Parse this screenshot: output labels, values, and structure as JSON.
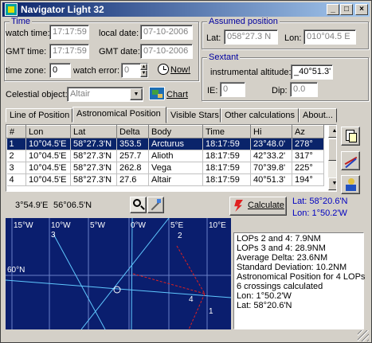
{
  "window": {
    "title": "Navigator Light 32",
    "controls": [
      "_",
      "□",
      "×"
    ]
  },
  "time": {
    "title": "Time",
    "watch_time_label": "watch time:",
    "watch_time": "17:17:59",
    "local_date_label": "local date:",
    "local_date": "07-10-2006",
    "gmt_time_label": "GMT time:",
    "gmt_time": "17:17:59",
    "gmt_date_label": "GMT date:",
    "gmt_date": "07-10-2006",
    "time_zone_label": "time zone:",
    "time_zone": "0",
    "watch_error_label": "watch error:",
    "watch_error": "0",
    "now_label": "Now!"
  },
  "assumed_position": {
    "title": "Assumed position",
    "lat_label": "Lat:",
    "lat": "058°27.3 N",
    "lon_label": "Lon:",
    "lon": "010°04.5 E"
  },
  "sextant": {
    "title": "Sextant",
    "altitude_label": "instrumental altitude:",
    "altitude": "_40°51.3'",
    "ie_label": "IE:",
    "ie": "0",
    "dip_label": "Dip:",
    "dip": "0.0"
  },
  "celestial": {
    "label": "Celestial object:",
    "selected": "Altair",
    "chart_label": "Chart"
  },
  "tabs": [
    {
      "label": "Line of Position"
    },
    {
      "label": "Astronomical Position"
    },
    {
      "label": "Visible Stars"
    },
    {
      "label": "Other calculations"
    },
    {
      "label": "About..."
    }
  ],
  "table": {
    "headers": [
      "#",
      "Lon",
      "Lat",
      "Delta",
      "Body",
      "Time",
      "Hi",
      "Az"
    ],
    "rows": [
      [
        "1",
        "10°04.5'E",
        "58°27.3'N",
        "353.5",
        "Arcturus",
        "18:17:59",
        "23°48.0'",
        "278°"
      ],
      [
        "2",
        "10°04.5'E",
        "58°27.3'N",
        "257.7",
        "Alioth",
        "18:17:59",
        "42°33.2'",
        "317°"
      ],
      [
        "3",
        "10°04.5'E",
        "58°27.3'N",
        "262.8",
        "Vega",
        "18:17:59",
        "70°39.8'",
        "225°"
      ],
      [
        "4",
        "10°04.5'E",
        "58°27.3'N",
        "27.6",
        "Altair",
        "18:17:59",
        "40°51.3'",
        "194°"
      ]
    ]
  },
  "coords_readout": {
    "x": "3°54.9'E",
    "y": "56°06.5'N"
  },
  "calculate_label": "Calculate",
  "calc_result": {
    "lat": "Lat: 58°20.6'N",
    "lon": "Lon:  1°50.2'W"
  },
  "map": {
    "lon_labels": [
      "15°W",
      "10°W",
      "5°W",
      "0°W",
      "5°E",
      "10°E"
    ],
    "lat_label": "60°N",
    "lop_numbers": [
      "1",
      "2",
      "3",
      "4"
    ],
    "colors": {
      "background": "#0a1e6e",
      "grid": "#6a80c8",
      "lop": "#60c8ff",
      "solution": "#e02020"
    }
  },
  "results_text": [
    "LOPs 2 and 4:  7.9NM",
    "LOPs 3 and 4: 28.9NM",
    "Average Delta: 23.6NM",
    "Standard Deviation: 10.2NM",
    "Astronomical Position for 4 LOPs",
    "6 crossings calculated",
    "Lon:   1°50.2'W",
    "Lat: 58°20.6'N"
  ]
}
